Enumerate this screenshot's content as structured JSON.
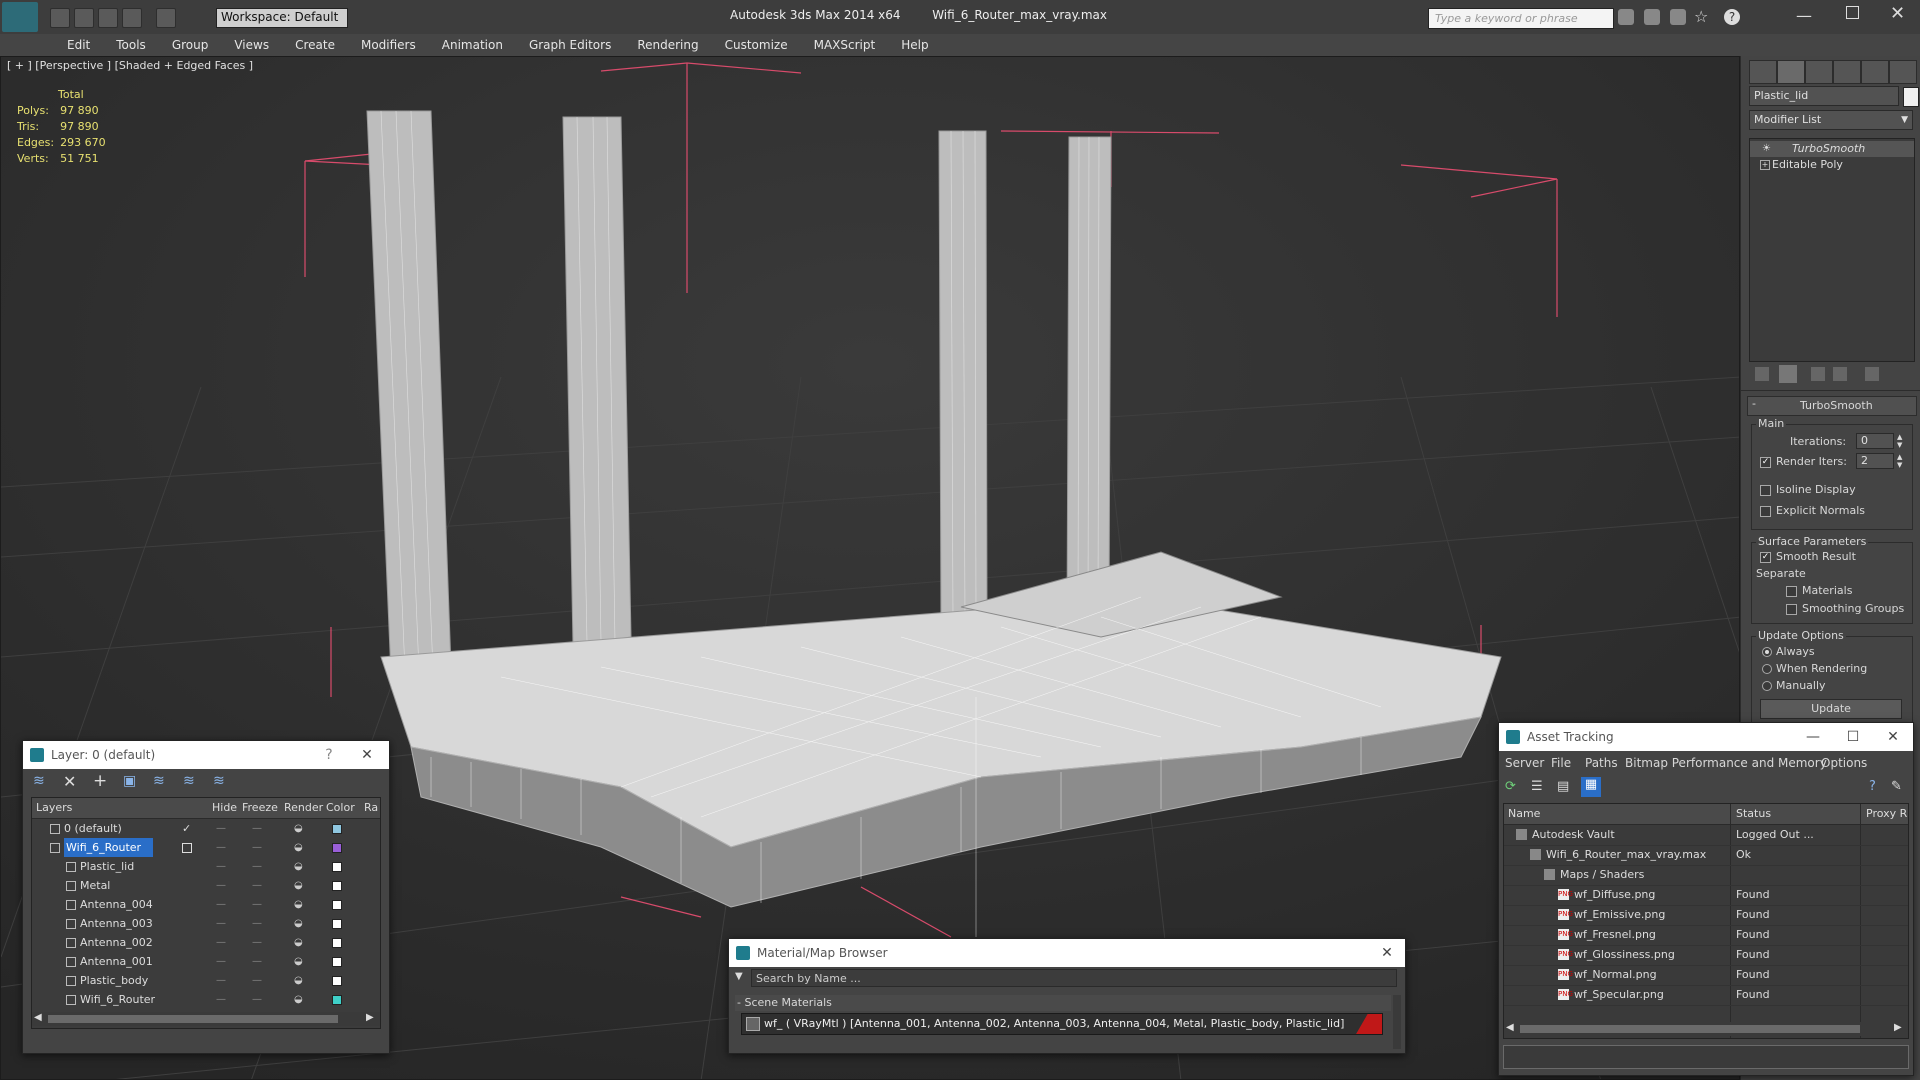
{
  "app": {
    "product": "Autodesk 3ds Max  2014 x64",
    "file": "Wifi_6_Router_max_vray.max",
    "workspace": "Workspace: Default",
    "search_placeholder": "Type a keyword or phrase"
  },
  "menu": [
    "Edit",
    "Tools",
    "Group",
    "Views",
    "Create",
    "Modifiers",
    "Animation",
    "Graph Editors",
    "Rendering",
    "Customize",
    "MAXScript",
    "Help"
  ],
  "viewport": {
    "label": "[ + ] [Perspective ] [Shaded + Edged Faces ]",
    "stats_header": "Total",
    "stats": [
      {
        "label": "Polys:",
        "value": "97 890"
      },
      {
        "label": "Tris:",
        "value": "97 890"
      },
      {
        "label": "Edges:",
        "value": "293 670"
      },
      {
        "label": "Verts:",
        "value": "51 751"
      }
    ]
  },
  "command_panel": {
    "object_name": "Plastic_lid",
    "modifier_list": "Modifier List",
    "stack": [
      "TurboSmooth",
      "Editable Poly"
    ],
    "rollout_title": "TurboSmooth",
    "main_label": "Main",
    "iterations_label": "Iterations:",
    "iterations_value": "0",
    "render_iters_label": "Render Iters:",
    "render_iters_value": "2",
    "isoline_label": "Isoline Display",
    "explicit_normals_label": "Explicit Normals",
    "surface_params_label": "Surface Parameters",
    "smooth_result_label": "Smooth Result",
    "separate_label": "Separate",
    "materials_label": "Materials",
    "smoothing_groups_label": "Smoothing Groups",
    "update_options_label": "Update Options",
    "always_label": "Always",
    "when_rendering_label": "When Rendering",
    "manually_label": "Manually",
    "update_button": "Update"
  },
  "layer_window": {
    "title": "Layer: 0 (default)",
    "help": "?",
    "columns": [
      "Layers",
      "Hide",
      "Freeze",
      "Render",
      "Color",
      "Ra"
    ],
    "rows": [
      {
        "name": "0 (default)",
        "indent": 1,
        "color": "#8fc7e0",
        "current": true
      },
      {
        "name": "Wifi_6_Router",
        "indent": 1,
        "color": "#9a5fd8",
        "selected": true
      },
      {
        "name": "Plastic_lid",
        "indent": 2,
        "color": "#ffffff"
      },
      {
        "name": "Metal",
        "indent": 2,
        "color": "#ffffff"
      },
      {
        "name": "Antenna_004",
        "indent": 2,
        "color": "#ffffff"
      },
      {
        "name": "Antenna_003",
        "indent": 2,
        "color": "#ffffff"
      },
      {
        "name": "Antenna_002",
        "indent": 2,
        "color": "#ffffff"
      },
      {
        "name": "Antenna_001",
        "indent": 2,
        "color": "#ffffff"
      },
      {
        "name": "Plastic_body",
        "indent": 2,
        "color": "#ffffff"
      },
      {
        "name": "Wifi_6_Router",
        "indent": 2,
        "color": "#3fd0c8"
      }
    ]
  },
  "material_browser": {
    "title": "Material/Map Browser",
    "search_placeholder": "Search by Name ...",
    "section": "- Scene Materials",
    "item": "wf_  ( VRayMtl ) [Antenna_001, Antenna_002, Antenna_003, Antenna_004, Metal, Plastic_body, Plastic_lid]"
  },
  "asset_tracking": {
    "title": "Asset Tracking",
    "menu": [
      "Server",
      "File",
      "Paths",
      "Bitmap Performance and Memory",
      "Options"
    ],
    "columns": [
      "Name",
      "Status",
      "Proxy R"
    ],
    "rows": [
      {
        "name": "Autodesk Vault",
        "status": "Logged Out ...",
        "indent": 1
      },
      {
        "name": "Wifi_6_Router_max_vray.max",
        "status": "Ok",
        "indent": 2
      },
      {
        "name": "Maps / Shaders",
        "status": "",
        "indent": 3
      },
      {
        "name": "wf_Diffuse.png",
        "status": "Found",
        "indent": 4
      },
      {
        "name": "wf_Emissive.png",
        "status": "Found",
        "indent": 4
      },
      {
        "name": "wf_Fresnel.png",
        "status": "Found",
        "indent": 4
      },
      {
        "name": "wf_Glossiness.png",
        "status": "Found",
        "indent": 4
      },
      {
        "name": "wf_Normal.png",
        "status": "Found",
        "indent": 4
      },
      {
        "name": "wf_Specular.png",
        "status": "Found",
        "indent": 4
      }
    ]
  },
  "colors": {
    "accent": "#1f7c8d",
    "selection": "#2a6ec8",
    "stats": "#e7e070",
    "bbox": "#d84b6b"
  }
}
